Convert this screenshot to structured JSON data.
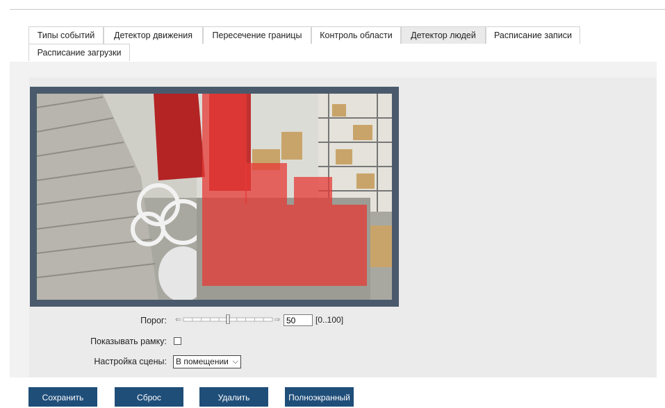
{
  "tabs": [
    {
      "label": "Типы событий",
      "active": false
    },
    {
      "label": "Детектор движения",
      "active": false
    },
    {
      "label": "Пересечение границы",
      "active": false
    },
    {
      "label": "Контроль области",
      "active": false
    },
    {
      "label": "Детектор людей",
      "active": true
    },
    {
      "label": "Расписание записи",
      "active": false
    },
    {
      "label": "Расписание загрузки",
      "active": false
    }
  ],
  "settings": {
    "threshold_label": "Порог:",
    "threshold_value": "50",
    "threshold_range": "[0..100]",
    "threshold_fraction": 0.5,
    "show_frame_label": "Показывать рамку:",
    "show_frame_checked": false,
    "scene_label": "Настройка сцены:",
    "scene_value": "В помещении"
  },
  "buttons": {
    "save": "Сохранить",
    "reset": "Сброс",
    "delete": "Удалить",
    "fullscreen": "Полноэкранный"
  },
  "colors": {
    "accent_button": "#1f4e79",
    "detection_overlay": "#e53935"
  }
}
